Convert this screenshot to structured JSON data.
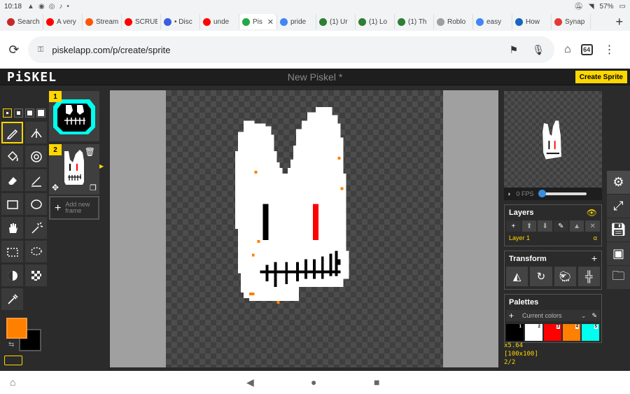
{
  "status": {
    "time": "10:18",
    "battery": "57%"
  },
  "browser": {
    "tabs": [
      {
        "label": "Search",
        "color": "#c62828"
      },
      {
        "label": "A very",
        "color": "#ff0000"
      },
      {
        "label": "Stream",
        "color": "#ff5500"
      },
      {
        "label": "SCRUB",
        "color": "#ff0000"
      },
      {
        "label": "• Disc",
        "color": "#3a5ee0"
      },
      {
        "label": "unde",
        "color": "#ff0000"
      },
      {
        "label": "Pis",
        "color": "#22aa44",
        "close": "✕"
      },
      {
        "label": "pride",
        "color": "#4285f4"
      },
      {
        "label": "(1) Ur",
        "color": "#2e7d32"
      },
      {
        "label": "(1) Lo",
        "color": "#2e7d32"
      },
      {
        "label": "(1) Th",
        "color": "#2e7d32"
      },
      {
        "label": "Roblo",
        "color": "#9e9e9e"
      },
      {
        "label": "easy",
        "color": "#4285f4"
      },
      {
        "label": "How",
        "color": "#1565c0"
      },
      {
        "label": "Synap",
        "color": "#e53935"
      }
    ],
    "active_tab_index": 6,
    "new_tab": "+",
    "url": "piskelapp.com/p/create/sprite",
    "tab_count": "64"
  },
  "app": {
    "logo": "PiSKEL",
    "title": "New Piskel *",
    "create_button": "Create Sprite"
  },
  "tools": {
    "pen_sizes": 4,
    "active_pen_size": 0,
    "items": [
      {
        "name": "pen-tool",
        "icon": "pencil-icon",
        "active": true
      },
      {
        "name": "vertical-mirror-pen-tool",
        "icon": "mirror-pen-icon"
      },
      {
        "name": "paint-bucket-tool",
        "icon": "bucket-icon"
      },
      {
        "name": "paint-all-same-color-tool",
        "icon": "target-icon"
      },
      {
        "name": "eraser-tool",
        "icon": "eraser-icon"
      },
      {
        "name": "stroke-tool",
        "icon": "stroke-icon"
      },
      {
        "name": "rectangle-tool",
        "icon": "rectangle-icon"
      },
      {
        "name": "circle-tool",
        "icon": "circle-icon"
      },
      {
        "name": "move-tool",
        "icon": "hand-icon"
      },
      {
        "name": "shape-selection-tool",
        "icon": "magic-wand-icon"
      },
      {
        "name": "rectangle-selection-tool",
        "icon": "dashed-rect-icon"
      },
      {
        "name": "lasso-selection-tool",
        "icon": "lasso-icon"
      },
      {
        "name": "lighten-tool",
        "icon": "lighten-icon"
      },
      {
        "name": "dithering-tool",
        "icon": "checker-icon"
      },
      {
        "name": "color-picker-tool",
        "icon": "eyedropper-icon"
      }
    ],
    "primary_color": "#ff7f00",
    "secondary_color": "#000000"
  },
  "frames": {
    "items": [
      {
        "number": "1"
      },
      {
        "number": "2",
        "active": true
      }
    ],
    "new_frame_label_line1": "Add new",
    "new_frame_label_line2": "frame"
  },
  "preview": {
    "fps": "0 FPS",
    "fps_value": 0
  },
  "layers": {
    "title": "Layers",
    "items": [
      {
        "name": "Layer 1",
        "alpha": "α"
      }
    ]
  },
  "transform": {
    "title": "Transform"
  },
  "palettes": {
    "title": "Palettes",
    "current": "Current colors",
    "colors": [
      {
        "index": "1",
        "hex": "#000000"
      },
      {
        "index": "2",
        "hex": "#ffffff"
      },
      {
        "index": "3",
        "hex": "#ff0000"
      },
      {
        "index": "4",
        "hex": "#ff7f00"
      },
      {
        "index": "5",
        "hex": "#00ffee"
      }
    ]
  },
  "stats": {
    "cursor": "x5.64",
    "size": "[100x100]",
    "frame": "2/2"
  }
}
